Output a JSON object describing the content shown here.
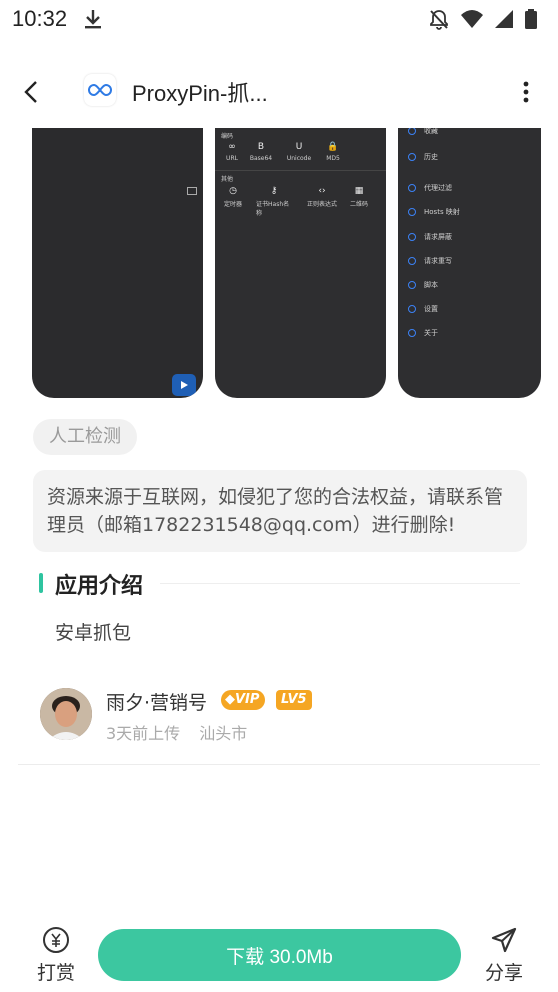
{
  "status_bar": {
    "time": "10:32",
    "icons": [
      "download-icon",
      "notifications-off-icon",
      "wifi-icon",
      "signal-icon",
      "battery-icon"
    ]
  },
  "app_bar": {
    "title": "ProxyPin-抓...",
    "back_icon": "back-arrow-icon",
    "menu_icon": "more-vert-icon"
  },
  "screenshots": {
    "shot2": {
      "section1": "编码",
      "row1": [
        "URL",
        "Base64",
        "Unicode",
        "MD5"
      ],
      "row1_glyphs": [
        "∞",
        "B",
        "U",
        "🔒"
      ],
      "section2": "其他",
      "row2": [
        "定时器",
        "证书Hash名称",
        "正则表达式",
        "二维码"
      ],
      "row2_glyphs": [
        "◷",
        "⚷",
        "‹›",
        "▦"
      ]
    },
    "shot3": {
      "items": [
        "收藏",
        "历史",
        "代理过滤",
        "Hosts 映射",
        "请求屏蔽",
        "请求重写",
        "脚本",
        "设置",
        "关于"
      ]
    }
  },
  "tag": "人工检测",
  "notice": "资源来源于互联网，如侵犯了您的合法权益，请联系管理员（邮箱1782231548@qq.com）进行删除!",
  "section": {
    "title": "应用介绍",
    "description": "安卓抓包"
  },
  "uploader": {
    "name": "雨夕·营销号",
    "vip_badge": "VIP",
    "level_badge": "LV5",
    "time": "3天前上传",
    "location": "汕头市"
  },
  "bottom": {
    "tip_label": "打赏",
    "download_label": "下载 30.0Mb",
    "share_label": "分享"
  },
  "colors": {
    "accent": "#3cc7a0",
    "section_bar": "#2ec4a0",
    "badge": "#f5a623"
  }
}
